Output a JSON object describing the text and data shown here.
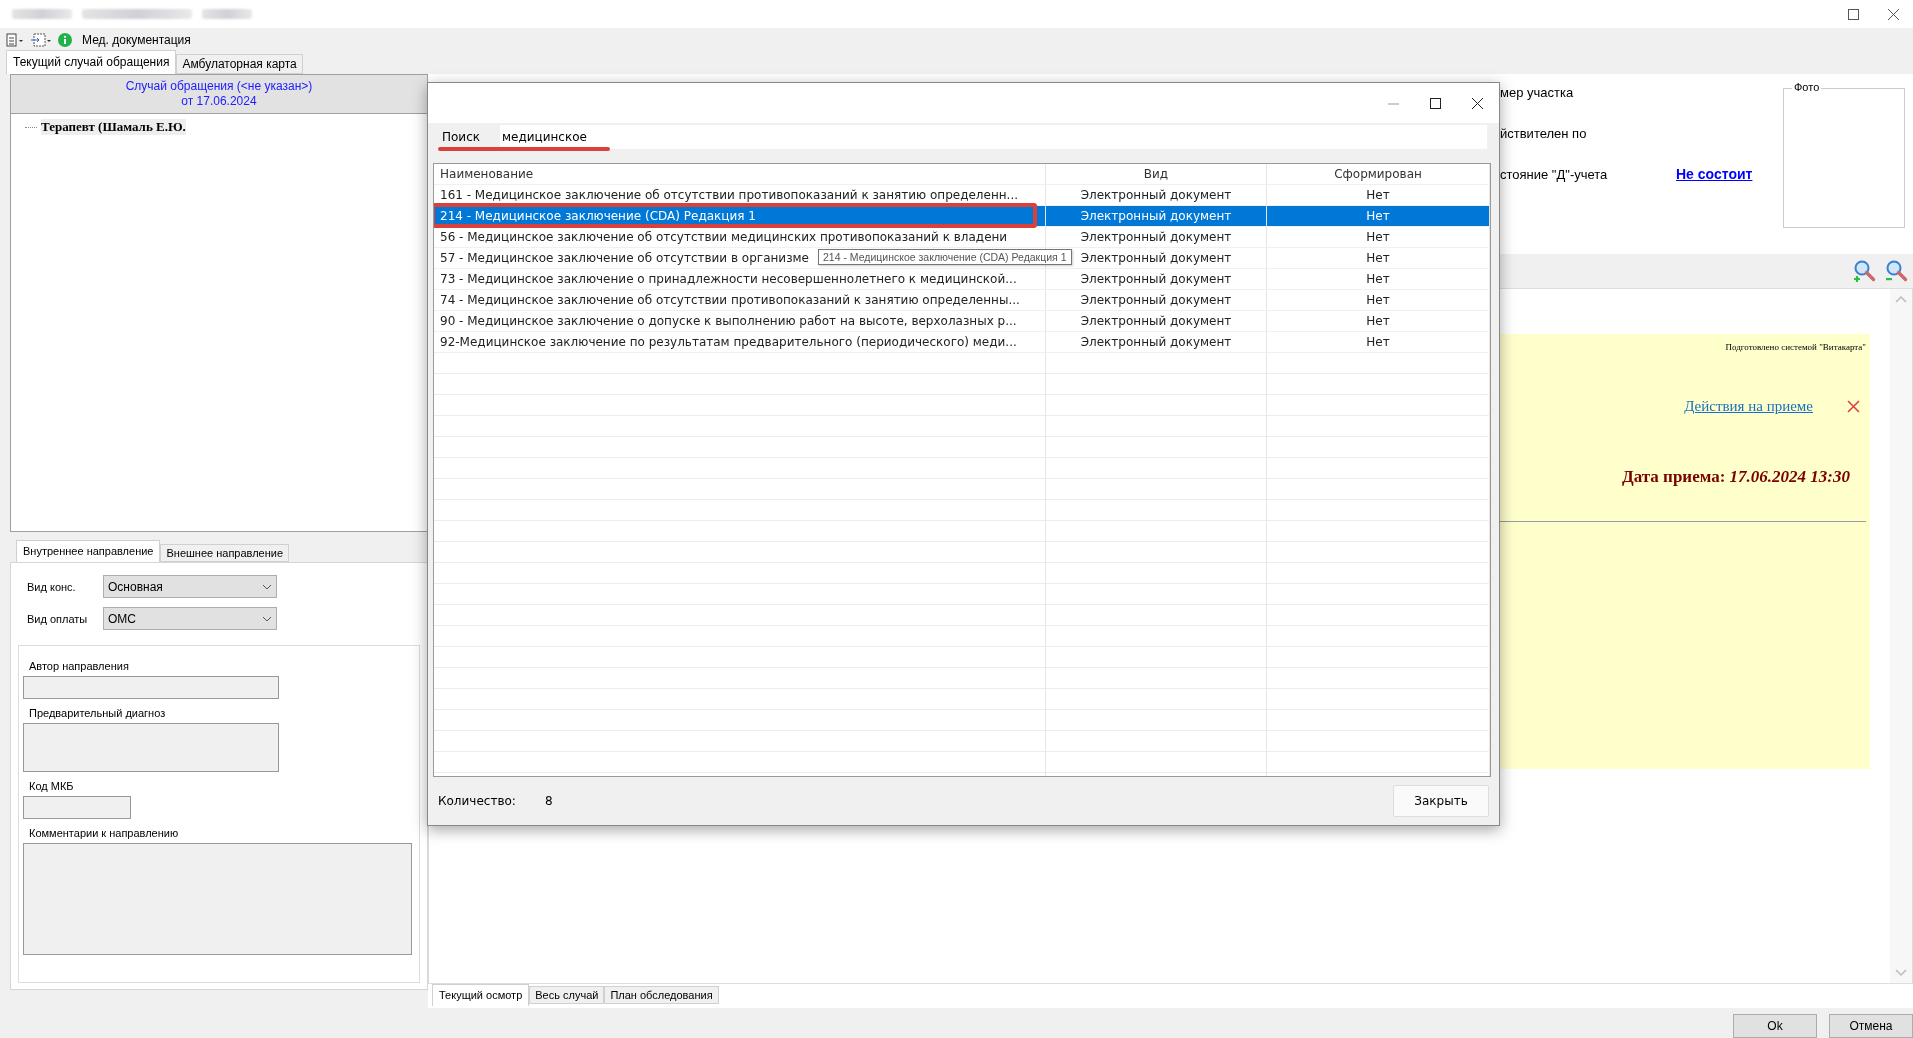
{
  "toolbar": {
    "title": "Мед. документация"
  },
  "main_tabs": [
    {
      "label": "Текущий случай обращения",
      "selected": true
    },
    {
      "label": "Амбулаторная карта",
      "selected": false
    }
  ],
  "case_panel": {
    "header_line1": "Случай обращения (<не указан>)",
    "header_line2": "от 17.06.2024",
    "tree": [
      {
        "label": "Терапевт (Шамаль Е.Ю."
      }
    ]
  },
  "referral_tabs": [
    {
      "label": "Внутреннее направление",
      "selected": true
    },
    {
      "label": "Внешнее направление",
      "selected": false
    }
  ],
  "referral_form": {
    "consult_type": {
      "label": "Вид конс.",
      "value": "Основная"
    },
    "payment_type": {
      "label": "Вид оплаты",
      "value": "ОМС"
    },
    "author": {
      "label": "Автор направления"
    },
    "diagnosis": {
      "label": "Предварительный диагноз"
    },
    "mkb_code": {
      "label": "Код МКБ"
    },
    "comment": {
      "label": "Комментарии к направлению"
    }
  },
  "patient_info": {
    "fields": [
      {
        "label": "мер участка"
      },
      {
        "label": "йствителен по"
      },
      {
        "label": "стояние \"Д\"-учета",
        "value": "Не состоит"
      }
    ],
    "photo_label": "Фото"
  },
  "document": {
    "prepared_by": "Подготовлено системой \"Витакарта\"",
    "actions_link": "Действия на приеме",
    "visit_date_label": "Дата приема:",
    "visit_date": "17.06.2024 13:30"
  },
  "document_tabs": [
    {
      "label": "Текущий осмотр",
      "selected": true
    },
    {
      "label": "Весь случай",
      "selected": false
    },
    {
      "label": "План обследования",
      "selected": false
    }
  ],
  "dialog": {
    "search_label": "Поиск",
    "search_value": "медицинское",
    "columns": [
      "Наименование",
      "Вид",
      "Сформирован"
    ],
    "rows": [
      {
        "name": "161 - Медицинское заключение об отсутствии противопоказаний к занятию определенн...",
        "type": "Электронный документ",
        "formed": "Нет",
        "selected": false
      },
      {
        "name": "214 - Медицинское заключение (CDA) Редакция 1",
        "type": "Электронный документ",
        "formed": "Нет",
        "selected": true
      },
      {
        "name": "56 - Медицинское заключение об отсутствии медицинских противопоказаний к владени",
        "type": "Электронный документ",
        "formed": "Нет",
        "selected": false
      },
      {
        "name": "57 - Медицинское заключение об отсутствии в организме",
        "type": "Электронный документ",
        "formed": "Нет",
        "selected": false
      },
      {
        "name": "73 - Медицинское заключение о принадлежности несовершеннолетнего к медицинской...",
        "type": "Электронный документ",
        "formed": "Нет",
        "selected": false
      },
      {
        "name": "74 - Медицинское заключение об отсутствии противопоказаний к занятию определенны...",
        "type": "Электронный документ",
        "formed": "Нет",
        "selected": false
      },
      {
        "name": "90 - Медицинское заключение о допуске к выполнению работ на высоте, верхолазных р...",
        "type": "Электронный документ",
        "formed": "Нет",
        "selected": false
      },
      {
        "name": "92-Медицинское заключение по результатам предварительного (периодического) меди...",
        "type": "Электронный документ",
        "formed": "Нет",
        "selected": false
      }
    ],
    "tooltip": "214 - Медицинское заключение (CDA) Редакция 1",
    "count_label": "Количество:",
    "count": "8",
    "close_button": "Закрыть"
  },
  "buttons": [
    "Ok",
    "Отмена"
  ]
}
